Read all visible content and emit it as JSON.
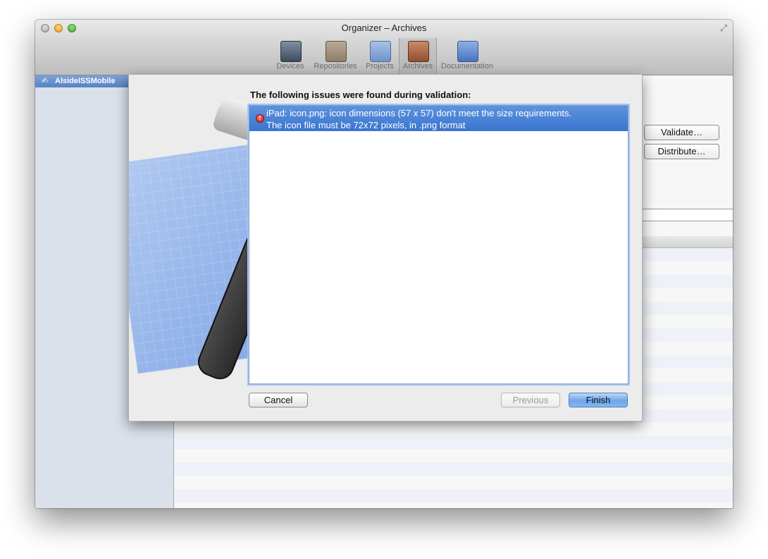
{
  "window": {
    "title": "Organizer – Archives"
  },
  "toolbar": {
    "items": [
      {
        "label": "Devices",
        "icon": "devices-icon"
      },
      {
        "label": "Repositories",
        "icon": "repositories-icon"
      },
      {
        "label": "Projects",
        "icon": "projects-icon"
      },
      {
        "label": "Archives",
        "icon": "archives-icon",
        "selected": true
      },
      {
        "label": "Documentation",
        "icon": "documentation-icon"
      }
    ]
  },
  "sidebar": {
    "items": [
      {
        "label": "AlsideISSMobile",
        "icon": "app-icon",
        "selected": true
      }
    ]
  },
  "main": {
    "validate_label": "Validate…",
    "distribute_label": "Distribute…"
  },
  "sheet": {
    "heading": "The following issues were found during validation:",
    "issues": [
      {
        "line1": "iPad: icon.png: icon dimensions (57 x 57) don't meet the size requirements.",
        "line2": "The icon file must be 72x72 pixels, in .png format",
        "icon": "error-icon"
      }
    ],
    "cancel_label": "Cancel",
    "previous_label": "Previous",
    "finish_label": "Finish"
  },
  "colors": {
    "selection": "#3a74cf",
    "sidebar_bg": "#dbe1ea",
    "error": "#c51612"
  }
}
